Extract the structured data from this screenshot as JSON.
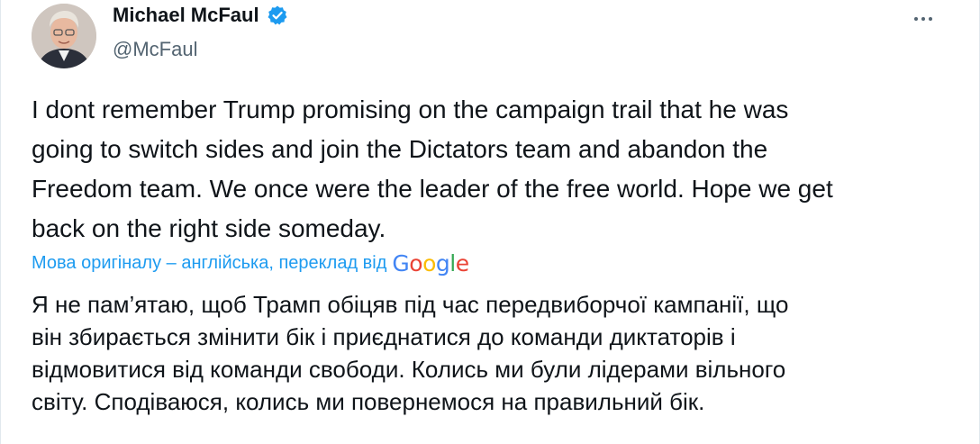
{
  "author": {
    "display_name": "Michael McFaul",
    "handle": "@McFaul",
    "verified": true
  },
  "icons": {
    "verified": "verified-badge-icon",
    "more": "more-options-icon",
    "google": "google-logo"
  },
  "tweet": {
    "text": "I dont remember Trump promising on the campaign trail that he was\ngoing to switch sides and join the Dictators team and abandon the\nFreedom team. We once were the leader of the free world.  Hope we get\nback on the right side someday."
  },
  "translation": {
    "label": "Мова оригіналу – англійська, переклад від",
    "provider": "Google",
    "text": "Я не пам’ятаю, щоб Трамп обіцяв під час передвиборчої кампанії, що\nвін збирається змінити бік і приєднатися до команди диктаторів і\nвідмовитися від команди свободи. Колись ми були лідерами вільного\nсвіту. Сподіваюся, колись ми повернемося на правильний бік."
  },
  "colors": {
    "text": "#0f1419",
    "secondary": "#536471",
    "accent": "#1d9bf0",
    "verified": "#1d9bf0"
  }
}
